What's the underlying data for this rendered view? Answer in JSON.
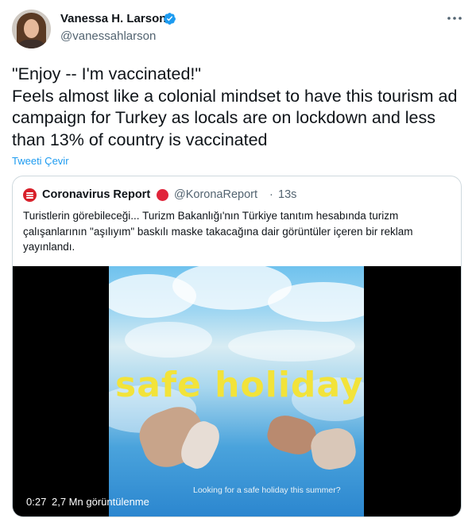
{
  "author": {
    "name": "Vanessa H. Larson",
    "handle": "@vanessahlarson",
    "verified": true
  },
  "tweet": {
    "text": "\"Enjoy -- I'm vaccinated!\"\nFeels almost like a colonial mindset to have this tourism ad campaign for Turkey as locals are on lockdown and less than 13% of country is vaccinated",
    "translate_label": "Tweeti Çevir"
  },
  "quoted": {
    "name": "Coronavirus Report",
    "handle": "@KoronaReport",
    "separator": "·",
    "time": "13s",
    "text": "Turistlerin görebileceği... Turizm Bakanlığı'nın Türkiye tanıtım hesabında turizm çalışanlarının \"aşılıyım\" baskılı maske takacağına dair görüntüler içeren bir reklam yayınlandı.",
    "video": {
      "overlay_text": "safe holiday",
      "subtitle": "Looking for a safe holiday this summer?",
      "duration": "0:27",
      "views": "2,7 Mn görüntülenme"
    }
  },
  "icons": {
    "verified": "verified-badge-icon",
    "more": "more-options-icon",
    "logo": "coronavirus-report-logo",
    "badge": "red-circle-badge"
  },
  "colors": {
    "accent": "#1d9bf0",
    "secondary_text": "#536471",
    "overlay_yellow": "#f2e33a"
  }
}
